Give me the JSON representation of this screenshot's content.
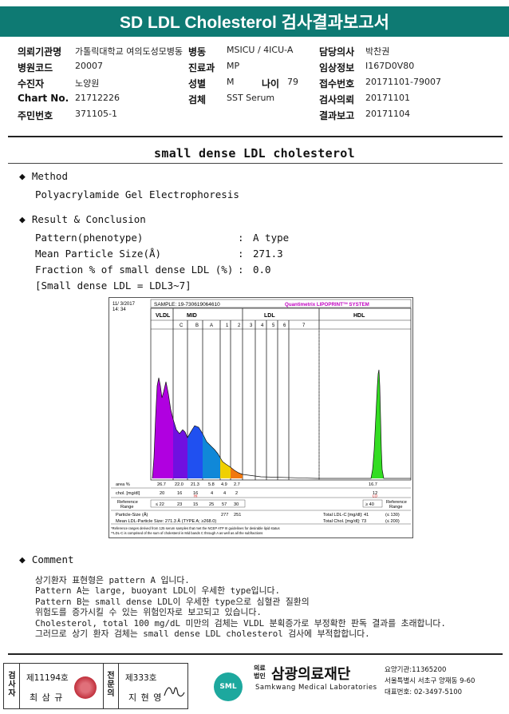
{
  "header": {
    "title": "SD LDL Cholesterol 검사결과보고서"
  },
  "info": {
    "institution_label": "의뢰기관명",
    "institution": "가톨릭대학교 여의도성모병동",
    "ward_label": "병동",
    "ward": "MSICU / 4ICU-A",
    "doctor_label": "담당의사",
    "doctor": "박찬권",
    "hospital_code_label": "병원코드",
    "hospital_code": "20007",
    "dept_label": "진료과",
    "dept": "MP",
    "clinical_label": "임상정보",
    "clinical": "I167D0V80",
    "examinee_label": "수진자",
    "examinee": "노양원",
    "sex_label": "성별",
    "sex": "M",
    "age_label": "나이",
    "age": "79",
    "receipt_label": "접수번호",
    "receipt": "20171101-79007",
    "chart_label": "Chart No.",
    "chart": "21712226",
    "specimen_label": "검체",
    "specimen": "SST Serum",
    "request_label": "검사의뢰",
    "request": "20171101",
    "id_label": "주민번호",
    "id": "371105-1",
    "report_label": "결과보고",
    "report": "20171104"
  },
  "report": {
    "title": "small dense LDL cholesterol",
    "method_heading": "Method",
    "method": "Polyacrylamide Gel Electrophoresis",
    "result_heading": "Result & Conclusion",
    "pattern_label": "Pattern(phenotype)",
    "pattern_value": "A type",
    "size_label": "Mean Particle Size(Å)",
    "size_value": "271.3",
    "fraction_label": "Fraction % of small dense LDL (%)",
    "fraction_value": "0.0",
    "colon": ":",
    "note": "[Small dense LDL = LDL3~7]",
    "comment_heading": "Comment",
    "comment_lines": [
      "상기환자 표현형은 pattern A 입니다.",
      "Pattern A는 large, buoyant LDL이 우세한 type입니다.",
      "Pattern B는 small dense LDL이 우세한 type으로 심혈관 질환의",
      "위험도를 증가시킬 수 있는 위험인자로 보고되고 있습니다.",
      "Cholesterol, total 100 mg/dL 미만의 검체는 VLDL 분획증가로 부정확한 판독 결과를 초래합니다.",
      "그러므로 상기 환자 검체는 small dense LDL cholesterol 검사에 부적합합니다."
    ]
  },
  "chart": {
    "date": "11/ 3/2017",
    "time": "14: 34",
    "sample": "SAMPLE:  19-730619064610",
    "brand": "Quantimetrix LIPOPRINT",
    "brand_sup": "TM",
    "brand_tail": " SYSTEM",
    "regions": [
      "VLDL",
      "MID",
      "LDL",
      "HDL"
    ],
    "bands": [
      "C",
      "B",
      "A",
      "1",
      "2",
      "3",
      "4",
      "5",
      "6",
      "7"
    ],
    "row_area": "area %",
    "row_chol": "chol. [mg/dl]",
    "row_ref": "Reference",
    "row_ref2": "Range",
    "area_values": [
      "26.7",
      "22.0",
      "21.3",
      "5.8",
      "4.9",
      "2.7",
      "16.7"
    ],
    "chol_values": [
      "20",
      "16",
      "16",
      "4",
      "4",
      "2",
      "12"
    ],
    "hi_flag": "HI",
    "lo_flag": "LO",
    "ref_values": [
      "≤ 22",
      "23",
      "15",
      "25",
      "57",
      "30",
      "≥ 40"
    ],
    "ref_right1": "Reference",
    "ref_right2": "Range",
    "particle_size": "Particle-Size (Å)",
    "ps_values": [
      "277",
      "251"
    ],
    "mean_size": "Mean LDL-Particle Size:   271.3 Å   (TYPE A; ≥268.0)",
    "total_ldl": "Total LDL-C [mg/dl]:   41",
    "total_ldl_ref": "(≤ 130)",
    "total_chol": "Total Chol. [mg/dl]:   73",
    "total_chol_ref": "(≤ 200)",
    "foot1": "*Reference ranges derived from 125 serum samples that met the NCEP ATP III guidelines for desirable lipid status",
    "foot2": "**LDL-C is comprised of the sum of cholesterol in Mid bands C through A as well as all the subfractions",
    "colors": {
      "vldl": "#b000e0",
      "c": "#7010e0",
      "b": "#2050f0",
      "a": "#1088d8",
      "ldl1": "#f0d000",
      "ldl2": "#f07810",
      "hdl": "#33dd22"
    }
  },
  "footer": {
    "v1": "검사자",
    "n1": "제11194호",
    "name1": "최 삼 규",
    "v2": "전문의",
    "n2": "제333호",
    "name2": "지 현 영",
    "sml": "SML",
    "org_small1": "의료",
    "org_small2": "법인",
    "org": "삼광의료재단",
    "org_en": "Samkwang Medical Laboratories",
    "code": "요양기관:11365200",
    "addr": "서울특별시 서초구 양재동 9-60",
    "tel": "대표번호: 02-3497-5100"
  }
}
